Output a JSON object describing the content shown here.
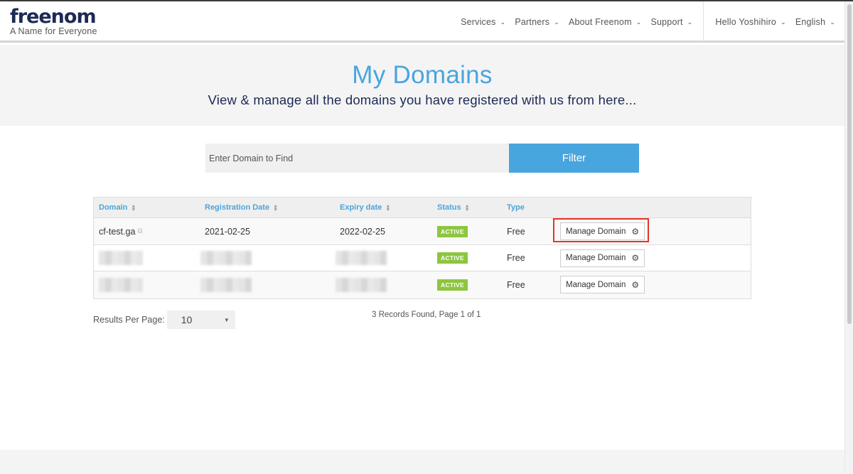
{
  "header": {
    "logo_text": "freenom",
    "logo_tagline": "A Name for Everyone",
    "nav": [
      "Services",
      "Partners",
      "About Freenom",
      "Support"
    ],
    "user_greeting": "Hello Yoshihiro",
    "language": "English"
  },
  "hero": {
    "title": "My Domains",
    "subtitle": "View & manage all the domains you have registered with us from here..."
  },
  "filter": {
    "placeholder": "Enter Domain to Find",
    "button_label": "Filter"
  },
  "table": {
    "columns": [
      "Domain",
      "Registration Date",
      "Expiry date",
      "Status",
      "Type"
    ],
    "rows": [
      {
        "domain": "cf-test.ga",
        "registration_date": "2021-02-25",
        "expiry_date": "2022-02-25",
        "status": "ACTIVE",
        "type": "Free",
        "action": "Manage Domain"
      },
      {
        "domain": "",
        "registration_date": "",
        "expiry_date": "",
        "status": "ACTIVE",
        "type": "Free",
        "action": "Manage Domain"
      },
      {
        "domain": "",
        "registration_date": "",
        "expiry_date": "",
        "status": "ACTIVE",
        "type": "Free",
        "action": "Manage Domain"
      }
    ]
  },
  "pagination": {
    "results_per_page_label": "Results Per Page:",
    "results_per_page_value": "10",
    "records_text": "3 Records Found, Page 1 of 1"
  },
  "colors": {
    "brand_blue": "#49a5de",
    "navy": "#1d2a55",
    "active_green": "#8dc63f",
    "highlight_red": "#e5352a"
  }
}
